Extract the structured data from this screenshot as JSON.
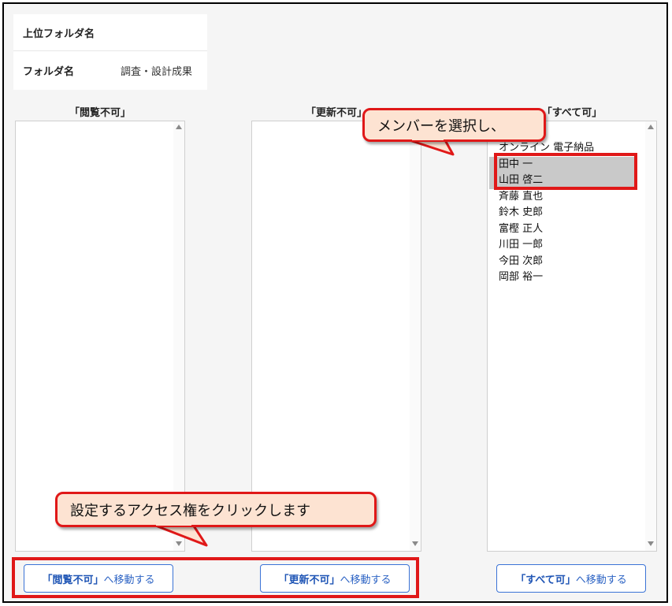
{
  "folder": {
    "parent_label": "上位フォルダ名",
    "parent_value": "",
    "name_label": "フォルダ名",
    "name_value": "調査・設計成果"
  },
  "columns": {
    "no_view": {
      "header": "「閲覧不可」",
      "members": []
    },
    "no_update": {
      "header": "「更新不可」",
      "members": []
    },
    "all_allowed": {
      "header": "「すべて可」",
      "members": [
        "オンライン 電子納品",
        "田中 一",
        "山田 啓二",
        "斉藤 直也",
        "鈴木 史郎",
        "富樫 正人",
        "川田 一郎",
        "今田 次郎",
        "岡部 裕一"
      ],
      "selected": [
        "田中 一",
        "山田 啓二"
      ]
    }
  },
  "buttons": {
    "no_view": {
      "key": "「閲覧不可」",
      "suffix": "へ移動する"
    },
    "no_update": {
      "key": "「更新不可」",
      "suffix": "へ移動する"
    },
    "all_allowed": {
      "key": "「すべて可」",
      "suffix": "へ移動する"
    }
  },
  "callouts": {
    "select_members": "メンバーを選択し、",
    "click_access": "設定するアクセス権をクリックします"
  },
  "colors": {
    "highlight_red": "#e01818",
    "callout_fill": "#fde3d2",
    "button_blue": "#2c63c4",
    "selected_row": "#c9c9c9"
  }
}
